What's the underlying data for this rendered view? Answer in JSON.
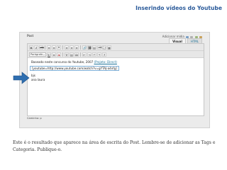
{
  "slide": {
    "title": "Inserindo vídeos do Youtube",
    "caption": "Este é o resultado que aparece na área de escrita do Post. Lembre-se de adicionar as Tags e Categoria. Publique-o."
  },
  "editor": {
    "label": "Post",
    "add_media": "Adicionar mídia",
    "tabs": [
      "Visual",
      "HTML"
    ],
    "active_tab": "Visual",
    "format_value": "Parágrafo",
    "toolbar_row1": [
      "B",
      "I",
      "ABC",
      "≡",
      "≡",
      "❝",
      "≡",
      "≡",
      "≡",
      "🔗",
      "⛓",
      "▤",
      "ABC",
      "⛶",
      "▦"
    ],
    "toolbar_row2": [
      "U",
      "≡",
      "A",
      "T",
      "▤",
      "Ω",
      "⇤",
      "⇥",
      "↶",
      "↷",
      "?"
    ],
    "content": {
      "line1_text": "Baseado neste concurso do Youtube, 2007 ",
      "line1_link": "(Projeto: Direct)",
      "embed_code": "[youtube=http://www.youtube.com/watch?v=gYTAJ-a4nfg]",
      "signoff": "bjs",
      "author": "ana laura"
    },
    "footer": "Caminho: p"
  },
  "colors": {
    "title": "#2a5a9a",
    "arrow": "#2f6fb0",
    "link": "#21759b"
  }
}
